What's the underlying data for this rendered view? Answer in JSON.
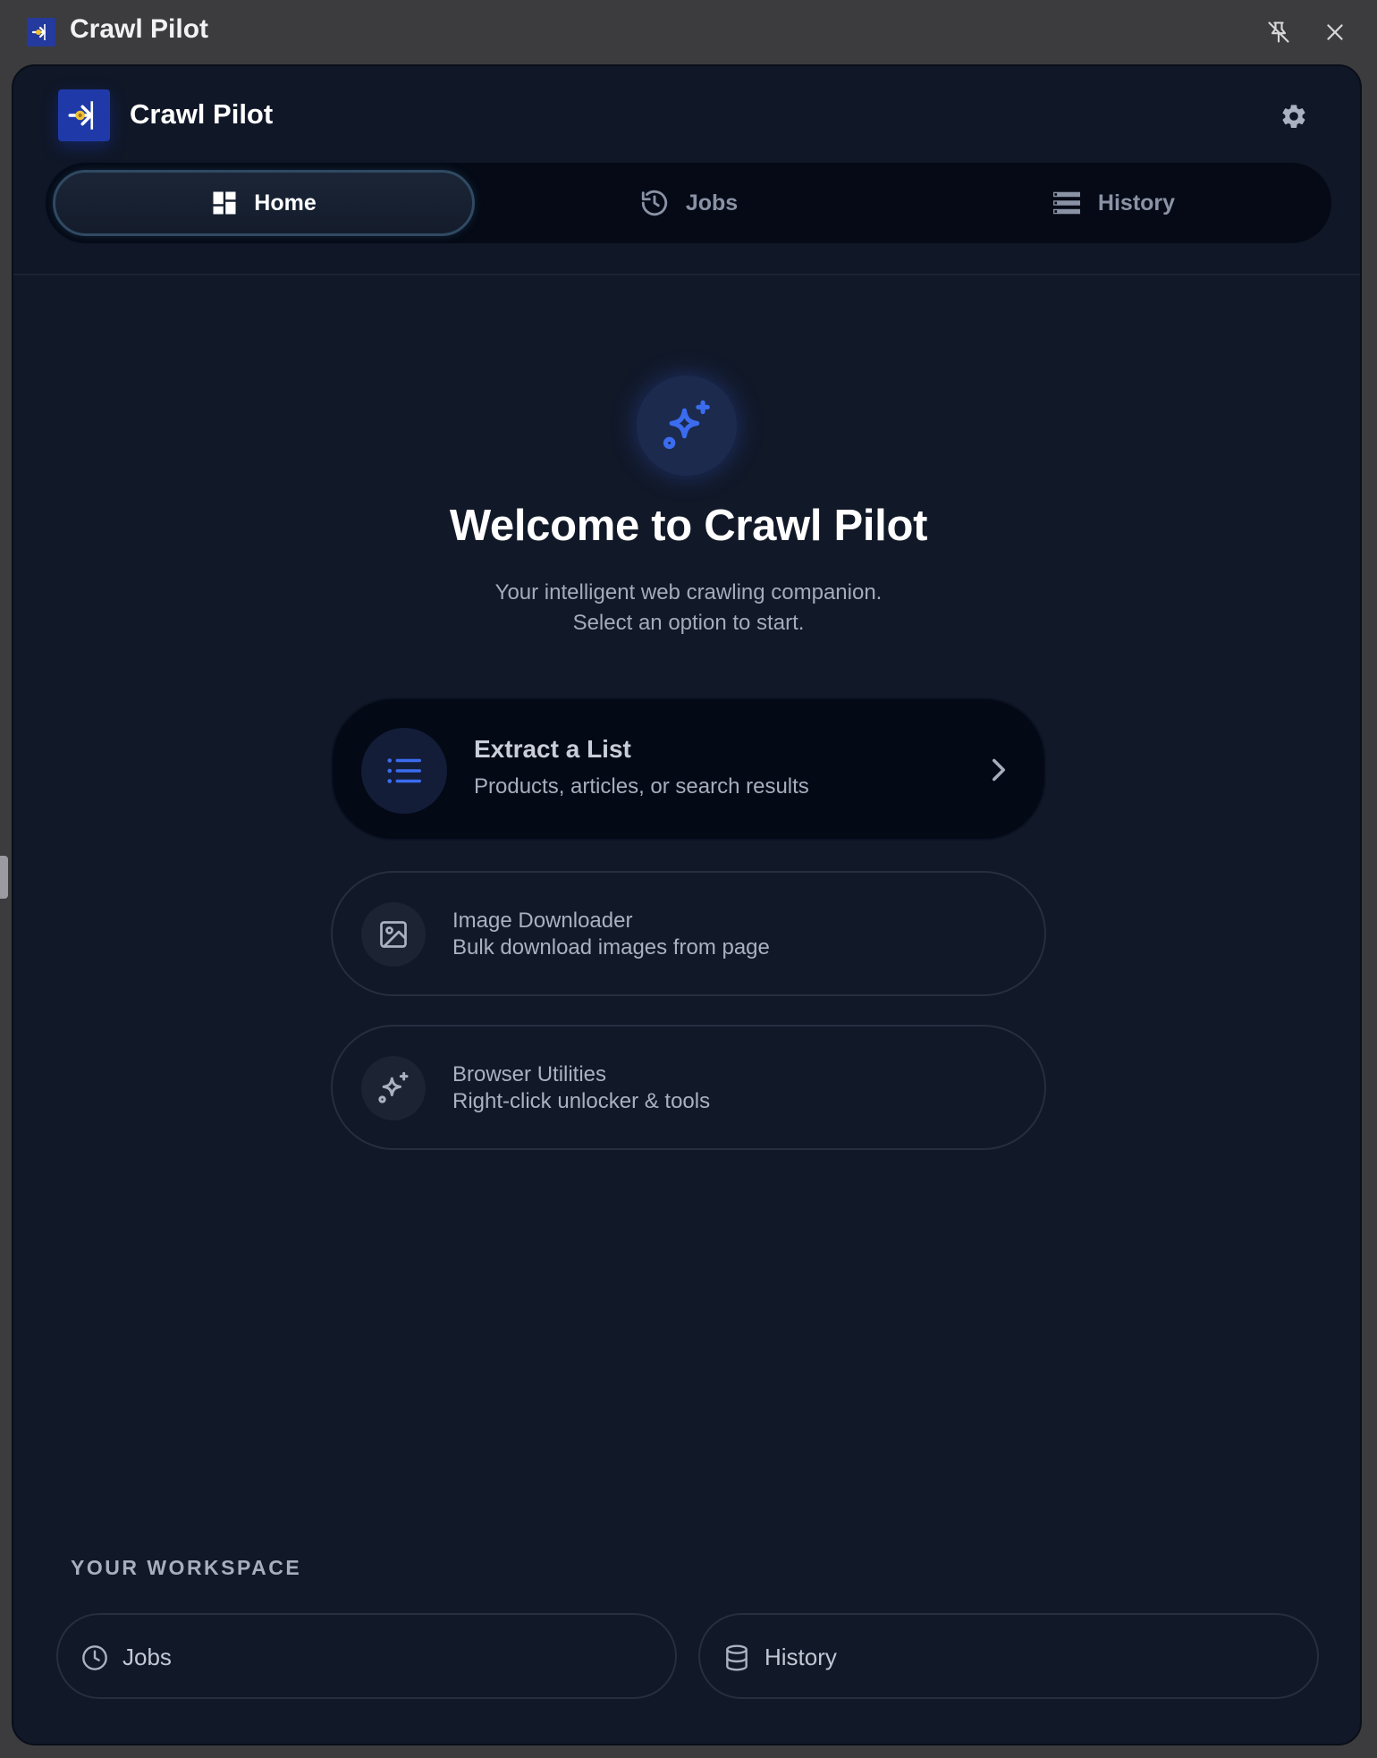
{
  "window": {
    "title": "Crawl Pilot",
    "pin_icon": "unpin-icon",
    "close_icon": "close-icon"
  },
  "header": {
    "brand_name": "Crawl Pilot",
    "settings_icon": "gear-icon"
  },
  "tabs": [
    {
      "label": "Home",
      "icon": "dashboard-icon",
      "active": true
    },
    {
      "label": "Jobs",
      "icon": "history-clock-icon",
      "active": false
    },
    {
      "label": "History",
      "icon": "list-rows-icon",
      "active": false
    }
  ],
  "hero": {
    "icon": "sparkles-icon",
    "title": "Welcome to Crawl Pilot",
    "subtitle_line1": "Your intelligent web crawling companion.",
    "subtitle_line2": "Select an option to start."
  },
  "options": [
    {
      "title": "Extract a List",
      "description": "Products, articles, or search results",
      "icon": "list-icon"
    },
    {
      "title": "Image Downloader",
      "description": "Bulk download images from page",
      "icon": "image-icon"
    },
    {
      "title": "Browser Utilities",
      "description": "Right-click unlocker & tools",
      "icon": "sparkles-icon"
    }
  ],
  "workspace": {
    "heading": "YOUR WORKSPACE",
    "items": [
      {
        "label": "Jobs",
        "icon": "clock-icon"
      },
      {
        "label": "History",
        "icon": "database-icon"
      }
    ]
  },
  "colors": {
    "accent": "#3b6cf0",
    "panel_bg": "#111828",
    "tabbar_bg": "#050a16",
    "primary_card_bg": "#040916"
  }
}
